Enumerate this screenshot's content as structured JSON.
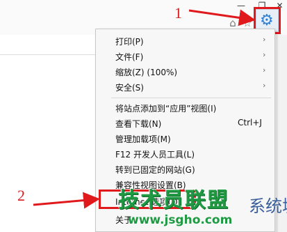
{
  "window": {
    "minimize_glyph": "—",
    "restore_glyph": "❐",
    "close_glyph": "✕"
  },
  "toolbar": {
    "home_icon": "home-icon",
    "favorites_icon": "star-icon",
    "tools_icon": "gear-icon",
    "home_glyph": "⌂",
    "favorites_glyph": "☆",
    "tools_glyph": "⚙"
  },
  "callouts": {
    "one": "1",
    "two": "2"
  },
  "menu": {
    "items": [
      {
        "label": "打印(P)",
        "submenu": true
      },
      {
        "label": "文件(F)",
        "submenu": true
      },
      {
        "label": "缩放(Z) (100%)",
        "submenu": true
      },
      {
        "label": "安全(S)",
        "submenu": true
      },
      {
        "label": "将站点添加到“应用”视图(I)",
        "submenu": false
      },
      {
        "label": "查看下载(N)",
        "shortcut": "Ctrl+J",
        "submenu": false
      },
      {
        "label": "管理加载项(M)",
        "submenu": false
      },
      {
        "label": "F12 开发人员工具(L)",
        "submenu": false
      },
      {
        "label": "转到已固定的网站(G)",
        "submenu": false
      },
      {
        "label": "兼容性视图设置(B)",
        "submenu": false
      },
      {
        "label": "Internet 选项(O)",
        "submenu": false
      },
      {
        "label": "关于",
        "submenu": false
      }
    ],
    "submenu_glyph": "›"
  },
  "watermark": {
    "logo": "技术员联盟",
    "url": "www.jsgho.com",
    "tail": "系统城"
  },
  "colors": {
    "callout_red": "#e0191c",
    "gear_blue": "#2e7fd6",
    "watermark_green": "#1f9a43"
  }
}
